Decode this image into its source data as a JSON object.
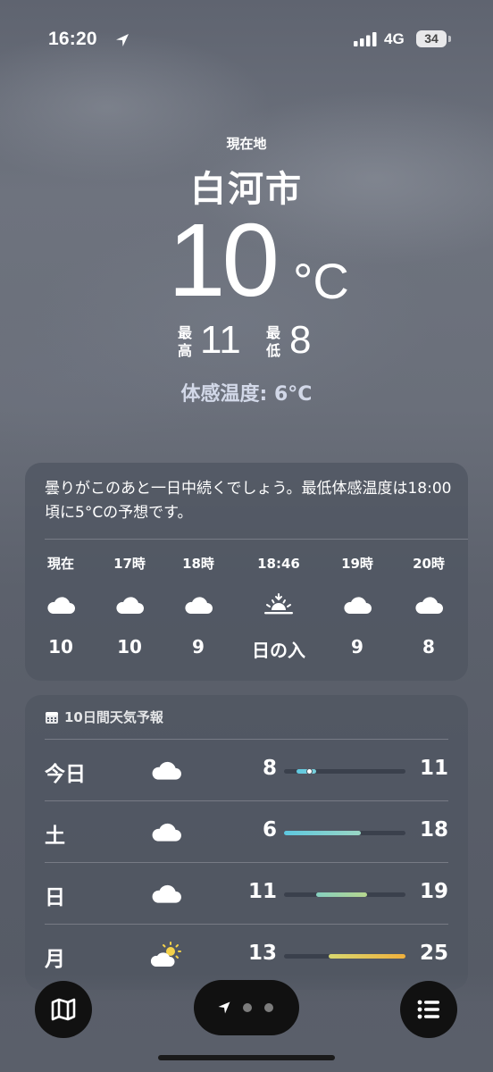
{
  "status_bar": {
    "time": "16:20",
    "network": "4G",
    "battery": "34"
  },
  "header": {
    "location_label": "現在地",
    "city": "白河市",
    "temperature": "10",
    "unit": "°C",
    "high_label": "最高",
    "high": "11",
    "low_label": "最低",
    "low": "8",
    "feels_like": "体感温度: 6°C"
  },
  "hourly": {
    "summary": "曇りがこのあと一日中続くでしょう。最低体感温度は18:00頃に5°Cの予想です。",
    "items": [
      {
        "time": "現在",
        "icon": "cloud-icon",
        "temp": "10"
      },
      {
        "time": "17時",
        "icon": "cloud-icon",
        "temp": "10"
      },
      {
        "time": "18時",
        "icon": "cloud-icon",
        "temp": "9"
      },
      {
        "time": "18:46",
        "icon": "sunset-icon",
        "temp": "日の入"
      },
      {
        "time": "19時",
        "icon": "cloud-icon",
        "temp": "9"
      },
      {
        "time": "20時",
        "icon": "cloud-icon",
        "temp": "8"
      }
    ]
  },
  "forecast": {
    "title": "10日間天気予報",
    "range_min": 6,
    "range_max": 25,
    "days": [
      {
        "day": "今日",
        "icon": "cloud-icon",
        "low": "8",
        "high": "11",
        "current": 10,
        "colors": [
          "#5ec8e0",
          "#78d0dc"
        ]
      },
      {
        "day": "土",
        "icon": "cloud-icon",
        "low": "6",
        "high": "18",
        "colors": [
          "#5ec8e0",
          "#9ad6c4"
        ]
      },
      {
        "day": "日",
        "icon": "cloud-icon",
        "low": "11",
        "high": "19",
        "colors": [
          "#86d0c0",
          "#b6d68e"
        ]
      },
      {
        "day": "月",
        "icon": "partly-sunny-icon",
        "low": "13",
        "high": "25",
        "colors": [
          "#d8d870",
          "#f0b03c"
        ]
      }
    ]
  }
}
